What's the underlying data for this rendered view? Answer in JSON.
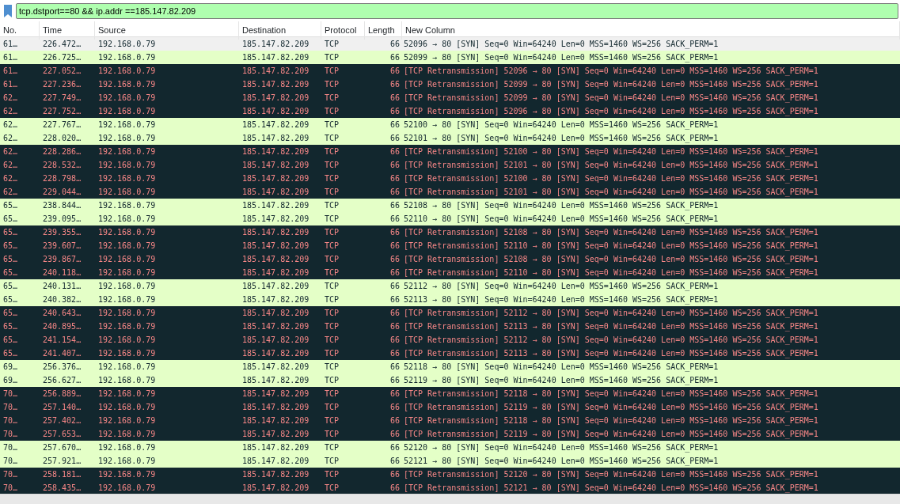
{
  "filter": {
    "value": "tcp.dstport==80 && ip.addr ==185.147.82.209"
  },
  "columns": [
    "No.",
    "Time",
    "Source",
    "Destination",
    "Protocol",
    "Length",
    "New Column"
  ],
  "rows": [
    {
      "kind": "syn",
      "selected": true,
      "no": "61…",
      "time": "226.472…",
      "source": "192.168.0.79",
      "destination": "185.147.82.209",
      "protocol": "TCP",
      "length": "66",
      "info": "52096 → 80 [SYN] Seq=0 Win=64240 Len=0 MSS=1460 WS=256 SACK_PERM=1"
    },
    {
      "kind": "syn",
      "selected": false,
      "no": "61…",
      "time": "226.725…",
      "source": "192.168.0.79",
      "destination": "185.147.82.209",
      "protocol": "TCP",
      "length": "66",
      "info": "52099 → 80 [SYN] Seq=0 Win=64240 Len=0 MSS=1460 WS=256 SACK_PERM=1"
    },
    {
      "kind": "retransmission",
      "selected": false,
      "no": "61…",
      "time": "227.052…",
      "source": "192.168.0.79",
      "destination": "185.147.82.209",
      "protocol": "TCP",
      "length": "66",
      "info": "[TCP Retransmission] 52096 → 80 [SYN] Seq=0 Win=64240 Len=0 MSS=1460 WS=256 SACK_PERM=1"
    },
    {
      "kind": "retransmission",
      "selected": false,
      "no": "61…",
      "time": "227.236…",
      "source": "192.168.0.79",
      "destination": "185.147.82.209",
      "protocol": "TCP",
      "length": "66",
      "info": "[TCP Retransmission] 52099 → 80 [SYN] Seq=0 Win=64240 Len=0 MSS=1460 WS=256 SACK_PERM=1"
    },
    {
      "kind": "retransmission",
      "selected": false,
      "no": "62…",
      "time": "227.749…",
      "source": "192.168.0.79",
      "destination": "185.147.82.209",
      "protocol": "TCP",
      "length": "66",
      "info": "[TCP Retransmission] 52099 → 80 [SYN] Seq=0 Win=64240 Len=0 MSS=1460 WS=256 SACK_PERM=1"
    },
    {
      "kind": "retransmission",
      "selected": false,
      "no": "62…",
      "time": "227.752…",
      "source": "192.168.0.79",
      "destination": "185.147.82.209",
      "protocol": "TCP",
      "length": "66",
      "info": "[TCP Retransmission] 52096 → 80 [SYN] Seq=0 Win=64240 Len=0 MSS=1460 WS=256 SACK_PERM=1"
    },
    {
      "kind": "syn",
      "selected": false,
      "no": "62…",
      "time": "227.767…",
      "source": "192.168.0.79",
      "destination": "185.147.82.209",
      "protocol": "TCP",
      "length": "66",
      "info": "52100 → 80 [SYN] Seq=0 Win=64240 Len=0 MSS=1460 WS=256 SACK_PERM=1"
    },
    {
      "kind": "syn",
      "selected": false,
      "no": "62…",
      "time": "228.020…",
      "source": "192.168.0.79",
      "destination": "185.147.82.209",
      "protocol": "TCP",
      "length": "66",
      "info": "52101 → 80 [SYN] Seq=0 Win=64240 Len=0 MSS=1460 WS=256 SACK_PERM=1"
    },
    {
      "kind": "retransmission",
      "selected": false,
      "no": "62…",
      "time": "228.286…",
      "source": "192.168.0.79",
      "destination": "185.147.82.209",
      "protocol": "TCP",
      "length": "66",
      "info": "[TCP Retransmission] 52100 → 80 [SYN] Seq=0 Win=64240 Len=0 MSS=1460 WS=256 SACK_PERM=1"
    },
    {
      "kind": "retransmission",
      "selected": false,
      "no": "62…",
      "time": "228.532…",
      "source": "192.168.0.79",
      "destination": "185.147.82.209",
      "protocol": "TCP",
      "length": "66",
      "info": "[TCP Retransmission] 52101 → 80 [SYN] Seq=0 Win=64240 Len=0 MSS=1460 WS=256 SACK_PERM=1"
    },
    {
      "kind": "retransmission",
      "selected": false,
      "no": "62…",
      "time": "228.798…",
      "source": "192.168.0.79",
      "destination": "185.147.82.209",
      "protocol": "TCP",
      "length": "66",
      "info": "[TCP Retransmission] 52100 → 80 [SYN] Seq=0 Win=64240 Len=0 MSS=1460 WS=256 SACK_PERM=1"
    },
    {
      "kind": "retransmission",
      "selected": false,
      "no": "62…",
      "time": "229.044…",
      "source": "192.168.0.79",
      "destination": "185.147.82.209",
      "protocol": "TCP",
      "length": "66",
      "info": "[TCP Retransmission] 52101 → 80 [SYN] Seq=0 Win=64240 Len=0 MSS=1460 WS=256 SACK_PERM=1"
    },
    {
      "kind": "syn",
      "selected": false,
      "no": "65…",
      "time": "238.844…",
      "source": "192.168.0.79",
      "destination": "185.147.82.209",
      "protocol": "TCP",
      "length": "66",
      "info": "52108 → 80 [SYN] Seq=0 Win=64240 Len=0 MSS=1460 WS=256 SACK_PERM=1"
    },
    {
      "kind": "syn",
      "selected": false,
      "no": "65…",
      "time": "239.095…",
      "source": "192.168.0.79",
      "destination": "185.147.82.209",
      "protocol": "TCP",
      "length": "66",
      "info": "52110 → 80 [SYN] Seq=0 Win=64240 Len=0 MSS=1460 WS=256 SACK_PERM=1"
    },
    {
      "kind": "retransmission",
      "selected": false,
      "no": "65…",
      "time": "239.355…",
      "source": "192.168.0.79",
      "destination": "185.147.82.209",
      "protocol": "TCP",
      "length": "66",
      "info": "[TCP Retransmission] 52108 → 80 [SYN] Seq=0 Win=64240 Len=0 MSS=1460 WS=256 SACK_PERM=1"
    },
    {
      "kind": "retransmission",
      "selected": false,
      "no": "65…",
      "time": "239.607…",
      "source": "192.168.0.79",
      "destination": "185.147.82.209",
      "protocol": "TCP",
      "length": "66",
      "info": "[TCP Retransmission] 52110 → 80 [SYN] Seq=0 Win=64240 Len=0 MSS=1460 WS=256 SACK_PERM=1"
    },
    {
      "kind": "retransmission",
      "selected": false,
      "no": "65…",
      "time": "239.867…",
      "source": "192.168.0.79",
      "destination": "185.147.82.209",
      "protocol": "TCP",
      "length": "66",
      "info": "[TCP Retransmission] 52108 → 80 [SYN] Seq=0 Win=64240 Len=0 MSS=1460 WS=256 SACK_PERM=1"
    },
    {
      "kind": "retransmission",
      "selected": false,
      "no": "65…",
      "time": "240.118…",
      "source": "192.168.0.79",
      "destination": "185.147.82.209",
      "protocol": "TCP",
      "length": "66",
      "info": "[TCP Retransmission] 52110 → 80 [SYN] Seq=0 Win=64240 Len=0 MSS=1460 WS=256 SACK_PERM=1"
    },
    {
      "kind": "syn",
      "selected": false,
      "no": "65…",
      "time": "240.131…",
      "source": "192.168.0.79",
      "destination": "185.147.82.209",
      "protocol": "TCP",
      "length": "66",
      "info": "52112 → 80 [SYN] Seq=0 Win=64240 Len=0 MSS=1460 WS=256 SACK_PERM=1"
    },
    {
      "kind": "syn",
      "selected": false,
      "no": "65…",
      "time": "240.382…",
      "source": "192.168.0.79",
      "destination": "185.147.82.209",
      "protocol": "TCP",
      "length": "66",
      "info": "52113 → 80 [SYN] Seq=0 Win=64240 Len=0 MSS=1460 WS=256 SACK_PERM=1"
    },
    {
      "kind": "retransmission",
      "selected": false,
      "no": "65…",
      "time": "240.643…",
      "source": "192.168.0.79",
      "destination": "185.147.82.209",
      "protocol": "TCP",
      "length": "66",
      "info": "[TCP Retransmission] 52112 → 80 [SYN] Seq=0 Win=64240 Len=0 MSS=1460 WS=256 SACK_PERM=1"
    },
    {
      "kind": "retransmission",
      "selected": false,
      "no": "65…",
      "time": "240.895…",
      "source": "192.168.0.79",
      "destination": "185.147.82.209",
      "protocol": "TCP",
      "length": "66",
      "info": "[TCP Retransmission] 52113 → 80 [SYN] Seq=0 Win=64240 Len=0 MSS=1460 WS=256 SACK_PERM=1"
    },
    {
      "kind": "retransmission",
      "selected": false,
      "no": "65…",
      "time": "241.154…",
      "source": "192.168.0.79",
      "destination": "185.147.82.209",
      "protocol": "TCP",
      "length": "66",
      "info": "[TCP Retransmission] 52112 → 80 [SYN] Seq=0 Win=64240 Len=0 MSS=1460 WS=256 SACK_PERM=1"
    },
    {
      "kind": "retransmission",
      "selected": false,
      "no": "65…",
      "time": "241.407…",
      "source": "192.168.0.79",
      "destination": "185.147.82.209",
      "protocol": "TCP",
      "length": "66",
      "info": "[TCP Retransmission] 52113 → 80 [SYN] Seq=0 Win=64240 Len=0 MSS=1460 WS=256 SACK_PERM=1"
    },
    {
      "kind": "syn",
      "selected": false,
      "no": "69…",
      "time": "256.376…",
      "source": "192.168.0.79",
      "destination": "185.147.82.209",
      "protocol": "TCP",
      "length": "66",
      "info": "52118 → 80 [SYN] Seq=0 Win=64240 Len=0 MSS=1460 WS=256 SACK_PERM=1"
    },
    {
      "kind": "syn",
      "selected": false,
      "no": "69…",
      "time": "256.627…",
      "source": "192.168.0.79",
      "destination": "185.147.82.209",
      "protocol": "TCP",
      "length": "66",
      "info": "52119 → 80 [SYN] Seq=0 Win=64240 Len=0 MSS=1460 WS=256 SACK_PERM=1"
    },
    {
      "kind": "retransmission",
      "selected": false,
      "no": "70…",
      "time": "256.889…",
      "source": "192.168.0.79",
      "destination": "185.147.82.209",
      "protocol": "TCP",
      "length": "66",
      "info": "[TCP Retransmission] 52118 → 80 [SYN] Seq=0 Win=64240 Len=0 MSS=1460 WS=256 SACK_PERM=1"
    },
    {
      "kind": "retransmission",
      "selected": false,
      "no": "70…",
      "time": "257.140…",
      "source": "192.168.0.79",
      "destination": "185.147.82.209",
      "protocol": "TCP",
      "length": "66",
      "info": "[TCP Retransmission] 52119 → 80 [SYN] Seq=0 Win=64240 Len=0 MSS=1460 WS=256 SACK_PERM=1"
    },
    {
      "kind": "retransmission",
      "selected": false,
      "no": "70…",
      "time": "257.402…",
      "source": "192.168.0.79",
      "destination": "185.147.82.209",
      "protocol": "TCP",
      "length": "66",
      "info": "[TCP Retransmission] 52118 → 80 [SYN] Seq=0 Win=64240 Len=0 MSS=1460 WS=256 SACK_PERM=1"
    },
    {
      "kind": "retransmission",
      "selected": false,
      "no": "70…",
      "time": "257.653…",
      "source": "192.168.0.79",
      "destination": "185.147.82.209",
      "protocol": "TCP",
      "length": "66",
      "info": "[TCP Retransmission] 52119 → 80 [SYN] Seq=0 Win=64240 Len=0 MSS=1460 WS=256 SACK_PERM=1"
    },
    {
      "kind": "syn",
      "selected": false,
      "no": "70…",
      "time": "257.670…",
      "source": "192.168.0.79",
      "destination": "185.147.82.209",
      "protocol": "TCP",
      "length": "66",
      "info": "52120 → 80 [SYN] Seq=0 Win=64240 Len=0 MSS=1460 WS=256 SACK_PERM=1"
    },
    {
      "kind": "syn",
      "selected": false,
      "no": "70…",
      "time": "257.921…",
      "source": "192.168.0.79",
      "destination": "185.147.82.209",
      "protocol": "TCP",
      "length": "66",
      "info": "52121 → 80 [SYN] Seq=0 Win=64240 Len=0 MSS=1460 WS=256 SACK_PERM=1"
    },
    {
      "kind": "retransmission",
      "selected": false,
      "no": "70…",
      "time": "258.181…",
      "source": "192.168.0.79",
      "destination": "185.147.82.209",
      "protocol": "TCP",
      "length": "66",
      "info": "[TCP Retransmission] 52120 → 80 [SYN] Seq=0 Win=64240 Len=0 MSS=1460 WS=256 SACK_PERM=1"
    },
    {
      "kind": "retransmission",
      "selected": false,
      "no": "70…",
      "time": "258.435…",
      "source": "192.168.0.79",
      "destination": "185.147.82.209",
      "protocol": "TCP",
      "length": "66",
      "info": "[TCP Retransmission] 52121 → 80 [SYN] Seq=0 Win=64240 Len=0 MSS=1460 WS=256 SACK_PERM=1"
    }
  ]
}
